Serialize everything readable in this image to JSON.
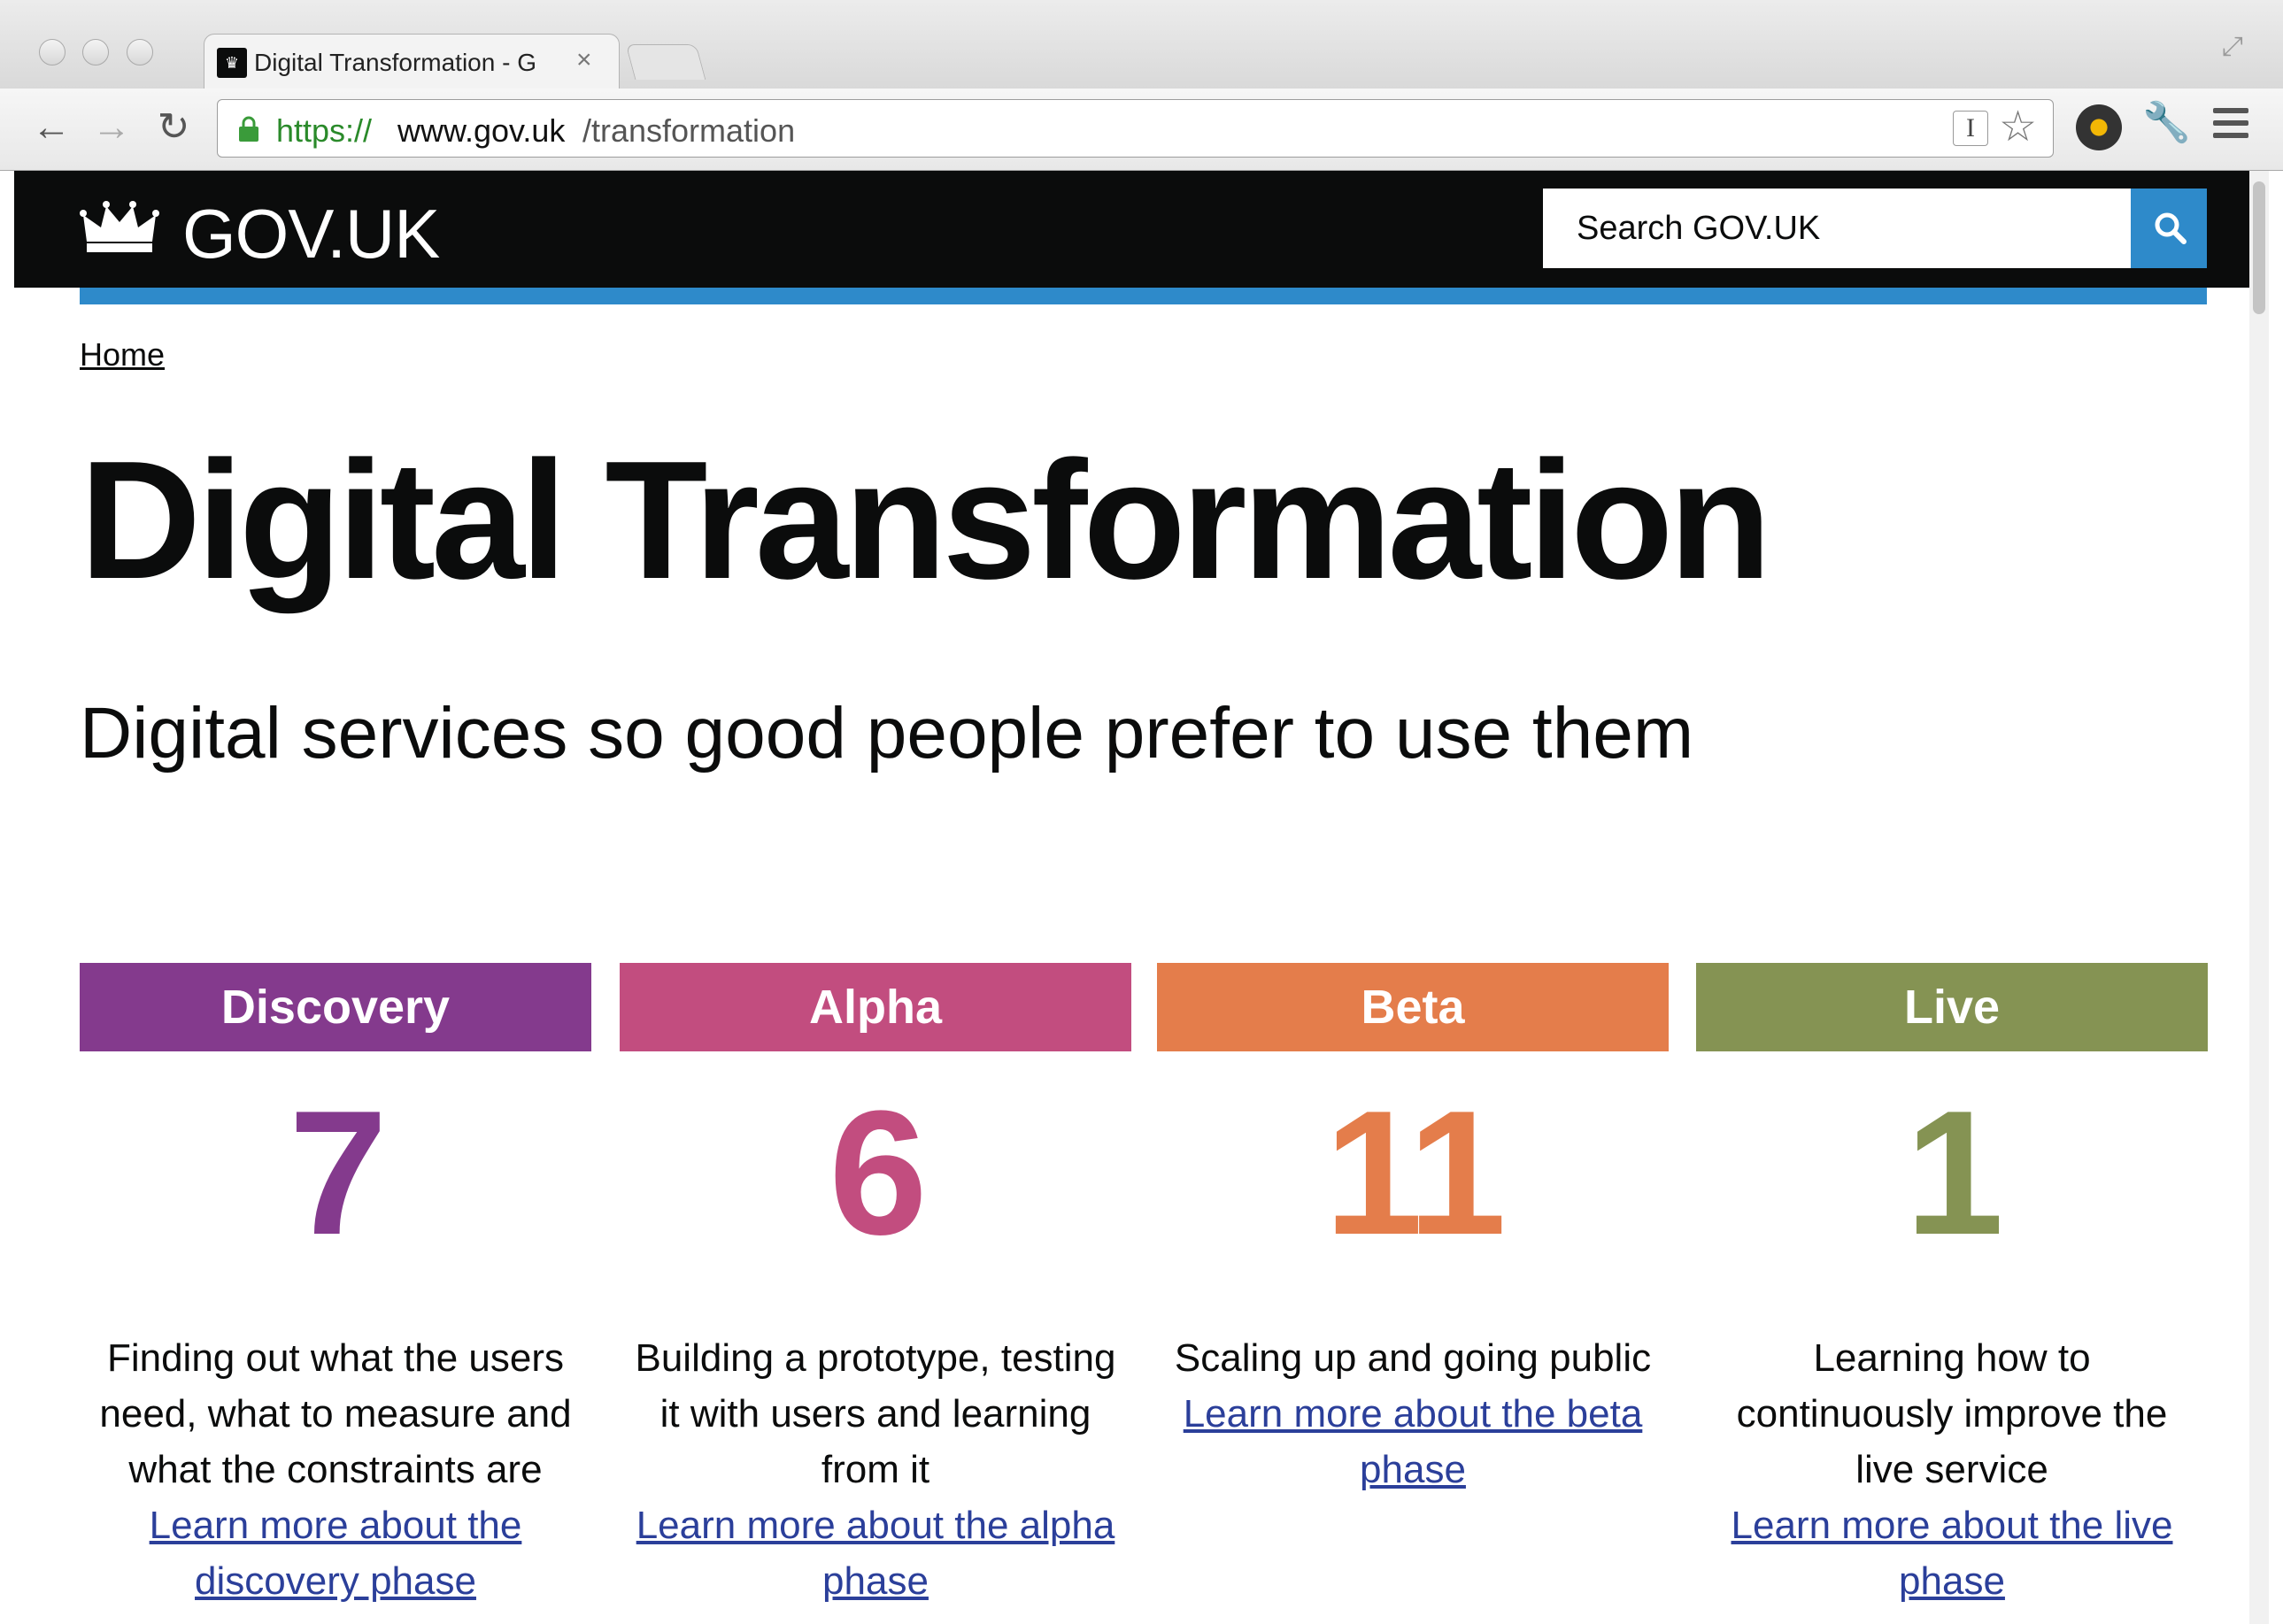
{
  "browser": {
    "tab_title": "Digital Transformation - G",
    "tab_close": "×",
    "url": {
      "scheme": "https://",
      "host": "www.gov.uk",
      "path": "/transformation"
    }
  },
  "site": {
    "name": "GOV.UK",
    "search_placeholder": "Search GOV.UK",
    "colors": {
      "header": "#0b0c0c",
      "accent": "#2e8aca",
      "link": "#2b3f9a"
    }
  },
  "breadcrumb": {
    "home": "Home"
  },
  "page": {
    "title": "Digital Transformation",
    "lede": "Digital services so good people prefer to use them"
  },
  "phases": [
    {
      "name": "Discovery",
      "count": "7",
      "color": "#843a8d",
      "description": "Finding out what the users need, what to measure and what the constraints are",
      "link": "Learn more about the discovery phase"
    },
    {
      "name": "Alpha",
      "count": "6",
      "color": "#c24d7f",
      "description": "Building a prototype, testing it with users and learning from it",
      "link": "Learn more about the alpha phase"
    },
    {
      "name": "Beta",
      "count": "11",
      "color": "#e47d4b",
      "description": "Scaling up and going public",
      "link": "Learn more about the beta phase"
    },
    {
      "name": "Live",
      "count": "1",
      "color": "#859353",
      "description": "Learning how to continuously improve the live service",
      "link": "Learn more about the live phase"
    }
  ]
}
